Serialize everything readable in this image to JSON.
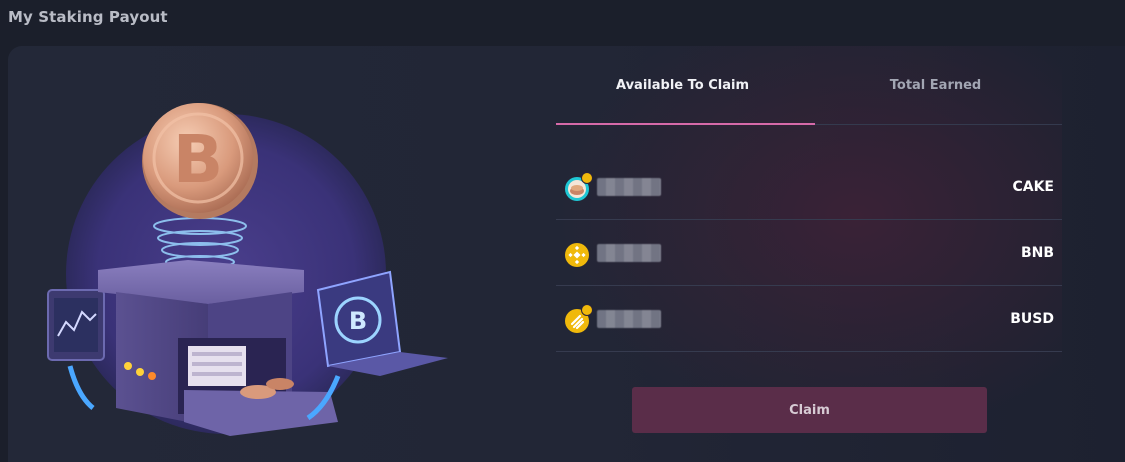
{
  "page": {
    "title": "My Staking Payout"
  },
  "tabs": [
    {
      "label": "Available To Claim",
      "active": true
    },
    {
      "label": "Total Earned",
      "active": false
    }
  ],
  "rows": [
    {
      "token": "CAKE",
      "icon": "cake-token-icon"
    },
    {
      "token": "BNB",
      "icon": "bnb-token-icon"
    },
    {
      "token": "BUSD",
      "icon": "busd-token-icon"
    }
  ],
  "claim": {
    "label": "Claim"
  },
  "colors": {
    "background": "#1b1f2b",
    "accent": "#d66aa9",
    "button": "#5a2d49",
    "bnb_yellow": "#f0b90b",
    "cake_teal": "#1fc7d4"
  }
}
